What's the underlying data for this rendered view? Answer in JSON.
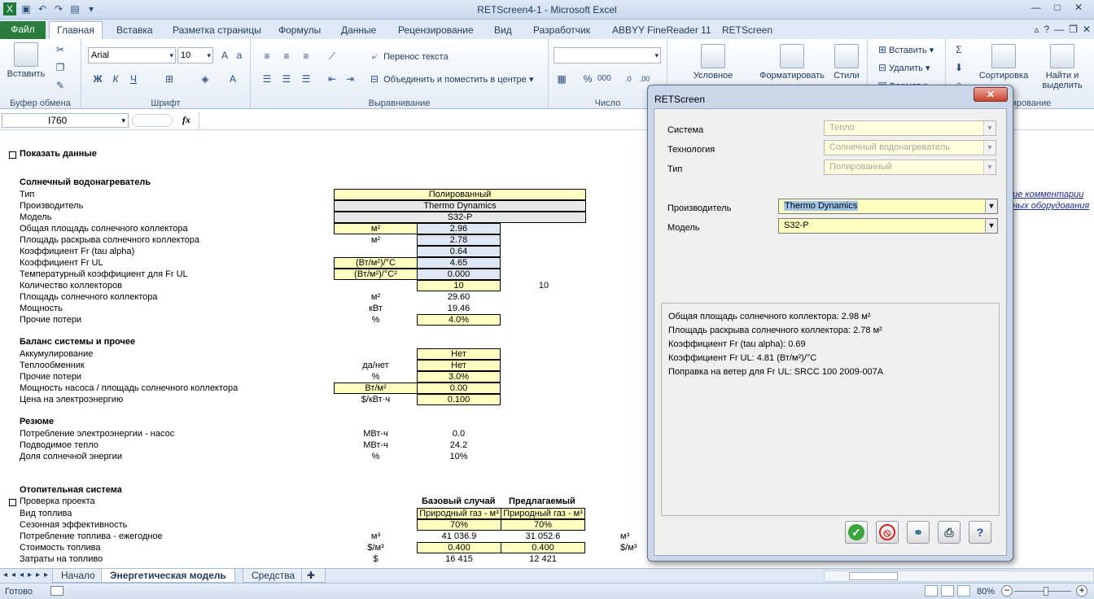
{
  "window": {
    "title": "RETScreen4-1 - Microsoft Excel"
  },
  "ribbon_tabs": [
    "Файл",
    "Главная",
    "Вставка",
    "Разметка страницы",
    "Формулы",
    "Данные",
    "Рецензирование",
    "Вид",
    "Разработчик",
    "ABBYY FineReader 11",
    "RETScreen"
  ],
  "ribbon": {
    "clipboard": {
      "paste": "Вставить",
      "group": "Буфер обмена"
    },
    "font": {
      "name": "Arial",
      "size": "10",
      "group": "Шрифт"
    },
    "alignment": {
      "wrap": "Перенос текста",
      "merge": "Объединить и поместить в центре",
      "group": "Выравнивание"
    },
    "number": {
      "group": "Число"
    },
    "styles": {
      "conditional": "Условное",
      "format_table": "Форматировать",
      "cell_styles": "Стили"
    },
    "cells": {
      "insert": "Вставить",
      "delete": "Удалить",
      "format": "Формат"
    },
    "editing": {
      "sort": "Сортировка",
      "find_1": "Найти и",
      "find_2": "выделить",
      "group": "ирование"
    }
  },
  "formula_bar": {
    "name_box": "I760",
    "fx": "fx"
  },
  "sheet": {
    "show_data": "Показать данные",
    "solar_heater": {
      "title": "Солнечный водонагреватель",
      "rows": [
        {
          "label": "Тип",
          "unit": "",
          "value": "Полированный"
        },
        {
          "label": "Производитель",
          "unit": "",
          "value": "Thermo Dynamics"
        },
        {
          "label": "Модель",
          "unit": "",
          "value": "S32-P"
        },
        {
          "label": "Общая площадь солнечного коллектора",
          "unit": "м²",
          "value": "2.96"
        },
        {
          "label": "Площадь раскрыва солнечного коллектора",
          "unit": "м²",
          "value": "2.78"
        },
        {
          "label": "Коэффициент Fr (tau alpha)",
          "unit": "",
          "value": "0.64"
        },
        {
          "label": "Коэффициент Fr UL",
          "unit": "(Вт/м²)/°C",
          "value": "4.65"
        },
        {
          "label": "Температурный коэффициент для Fr UL",
          "unit": "(Вт/м²)/°C²",
          "value": "0.000"
        },
        {
          "label": "Количество коллекторов",
          "unit": "",
          "value": "10",
          "extra": "10"
        },
        {
          "label": "Площадь солнечного коллектора",
          "unit": "м²",
          "value": "29.60"
        },
        {
          "label": "Мощность",
          "unit": "кВт",
          "value": "19.46"
        },
        {
          "label": "Прочие потери",
          "unit": "%",
          "value": "4.0%"
        }
      ]
    },
    "balance": {
      "title": "Баланс системы и прочее",
      "rows": [
        {
          "label": "Аккумулирование",
          "unit": "",
          "value": "Нет"
        },
        {
          "label": "Теплообменник",
          "unit": "да/нет",
          "value": "Нет"
        },
        {
          "label": "Прочие потери",
          "unit": "%",
          "value": "3.0%"
        },
        {
          "label": "Мощность насоса / площадь солнечного коллектора",
          "unit": "Вт/м²",
          "value": "0.00"
        },
        {
          "label": "Цена на электроэнергию",
          "unit": "$/кВт·ч",
          "value": "0.100"
        }
      ]
    },
    "summary": {
      "title": "Резюме",
      "rows": [
        {
          "label": "Потребление электроэнергии - насос",
          "unit": "МВт-ч",
          "value": "0.0"
        },
        {
          "label": "Подводимое тепло",
          "unit": "МВт-ч",
          "value": "24.2"
        },
        {
          "label": "Доля солнечной энергии",
          "unit": "%",
          "value": "10%"
        }
      ]
    },
    "heating": {
      "title": "Отопительная система",
      "check": "Проверка проекта",
      "col_base": "Базовый случай",
      "col_proposed": "Предлагаемый",
      "rows": [
        {
          "label": "Вид топлива",
          "unit": "",
          "base": "Природный газ - м³",
          "proposed": "Природный газ - м³",
          "extra": ""
        },
        {
          "label": "Сезонная эффективность",
          "unit": "",
          "base": "70%",
          "proposed": "70%",
          "extra": ""
        },
        {
          "label": "Потребление топлива - ежегодное",
          "unit": "м³",
          "base": "41 036.9",
          "proposed": "31 052.6",
          "extra": "м³"
        },
        {
          "label": "Стоимость топлива",
          "unit": "$/м³",
          "base": "0.400",
          "proposed": "0.400",
          "extra": "$/м³"
        },
        {
          "label": "Затраты на топливо",
          "unit": "$",
          "base": "16 415",
          "proposed": "12 421",
          "extra": ""
        }
      ]
    },
    "links": [
      "ие комментарии",
      "ных оборудования"
    ]
  },
  "sheet_tabs": [
    "Начало",
    "Энергетическая модель",
    "Средства"
  ],
  "status": {
    "ready": "Готово",
    "zoom": "80%"
  },
  "dialog": {
    "title": "RETScreen",
    "fields": [
      {
        "label": "Система",
        "value": "Тепло"
      },
      {
        "label": "Технология",
        "value": "Солнечный водонагреватель"
      },
      {
        "label": "Тип",
        "value": "Полированный"
      },
      {
        "label": "Производитель",
        "value": "Thermo Dynamics"
      },
      {
        "label": "Модель",
        "value": "S32-P"
      }
    ],
    "info": [
      "Общая площадь солнечного коллектора:   2.98 м²",
      "Площадь раскрыва солнечного коллектора:   2.78 м²",
      "Коэффициент Fr (tau alpha):   0.69",
      "Коэффициент Fr UL:   4.81 (Вт/м²)/°C",
      "Поправка на ветер для Fr UL:   SRCC 100 2009-007A"
    ],
    "buttons": [
      "ok-icon",
      "cancel-icon",
      "link-icon",
      "print-icon",
      "help-icon"
    ]
  }
}
